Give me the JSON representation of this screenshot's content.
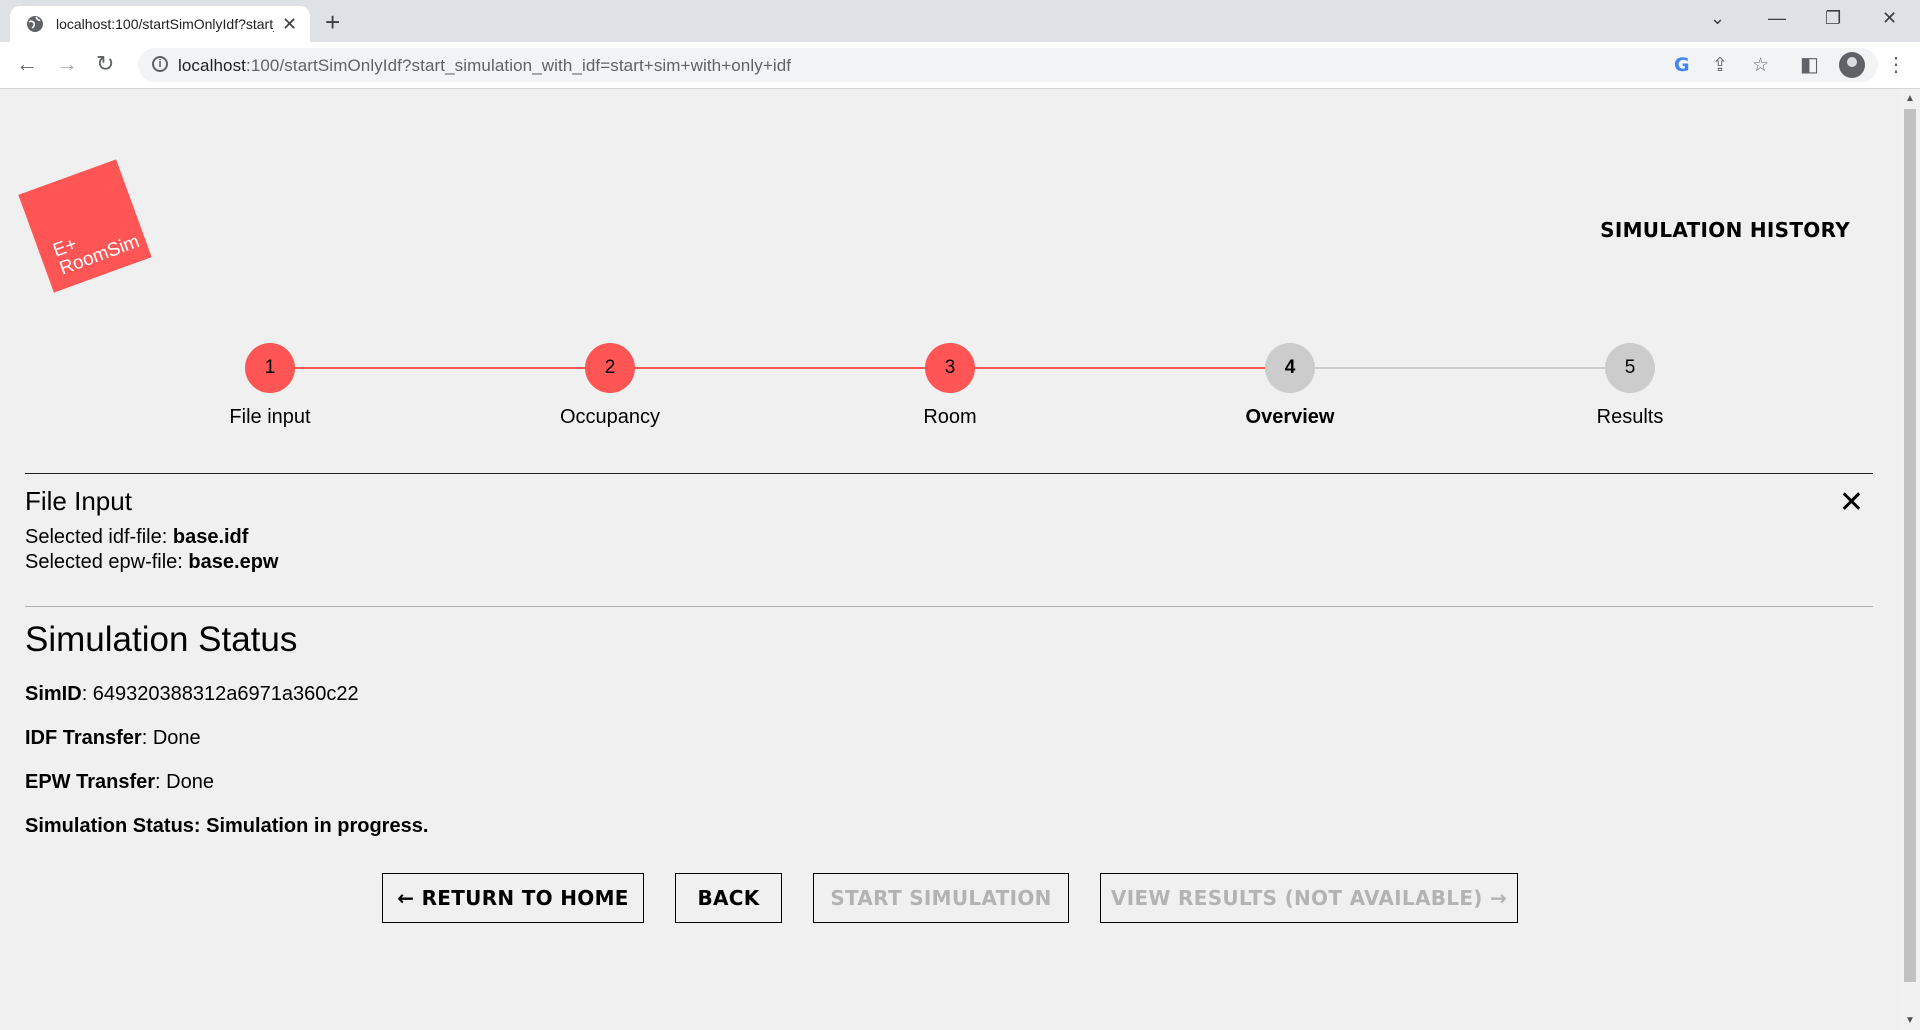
{
  "browser": {
    "tab_title": "localhost:100/startSimOnlyIdf?start_simulation_with_idf=start+sim+with+only+idf",
    "url_host": "localhost",
    "url_rest": ":100/startSimOnlyIdf?start_simulation_with_idf=start+sim+with+only+idf"
  },
  "header": {
    "logo_line1": "E+",
    "logo_line2": "RoomSim",
    "simulation_history": "SIMULATION HISTORY",
    "accent_color": "#ff5555"
  },
  "stepper": {
    "steps": [
      {
        "number": "1",
        "label": "File input",
        "state": "done"
      },
      {
        "number": "2",
        "label": "Occupancy",
        "state": "done"
      },
      {
        "number": "3",
        "label": "Room",
        "state": "done"
      },
      {
        "number": "4",
        "label": "Overview",
        "state": "active"
      },
      {
        "number": "5",
        "label": "Results",
        "state": "todo"
      }
    ]
  },
  "file_input": {
    "title": "File Input",
    "idf_label": "Selected idf-file: ",
    "idf_value": "base.idf",
    "epw_label": "Selected epw-file: ",
    "epw_value": "base.epw"
  },
  "simulation_status": {
    "title": "Simulation Status",
    "simid_label": "SimID",
    "simid_value": ": 649320388312a6971a360c22",
    "idf_transfer_label": "IDF Transfer",
    "idf_transfer_value": ": Done",
    "epw_transfer_label": "EPW Transfer",
    "epw_transfer_value": ": Done",
    "status_line": "Simulation Status: Simulation in progress."
  },
  "actions": {
    "return_home": "← RETURN TO HOME",
    "back": "BACK",
    "start_simulation": "START SIMULATION",
    "view_results": "VIEW RESULTS (NOT AVAILABLE) →"
  }
}
